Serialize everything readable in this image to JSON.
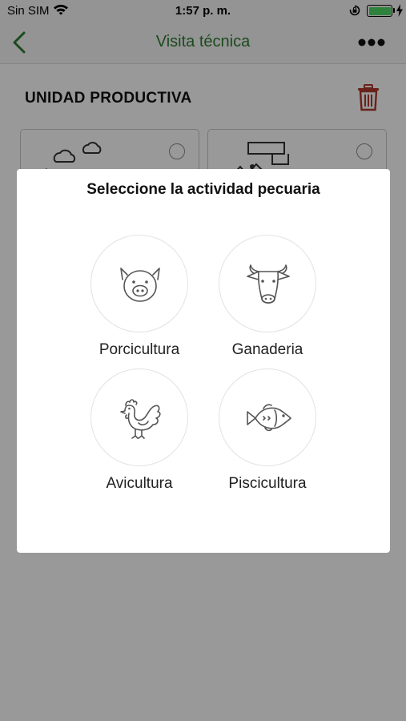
{
  "status_bar": {
    "carrier": "Sin SIM",
    "time": "1:57 p. m.",
    "battery_level": 1.0,
    "battery_color": "#4cd964"
  },
  "nav": {
    "title": "Visita técnica",
    "back_icon": "chevron-left-icon",
    "more_icon": "ellipsis-icon",
    "accent_color": "#2e7d32"
  },
  "section": {
    "title": "UNIDAD PRODUCTIVA",
    "delete_icon": "trash-icon",
    "delete_color": "#b03a2e"
  },
  "type_cards": [
    {
      "icon": "crops-landscape-icon",
      "selected": false
    },
    {
      "icon": "livestock-farm-icon",
      "selected": false
    }
  ],
  "modal": {
    "title": "Seleccione la actividad pecuaria",
    "options": [
      {
        "label": "Porcicultura",
        "icon": "pig-icon"
      },
      {
        "label": "Ganaderia",
        "icon": "cow-icon"
      },
      {
        "label": "Avicultura",
        "icon": "rooster-icon"
      },
      {
        "label": "Piscicultura",
        "icon": "fish-icon"
      }
    ]
  }
}
